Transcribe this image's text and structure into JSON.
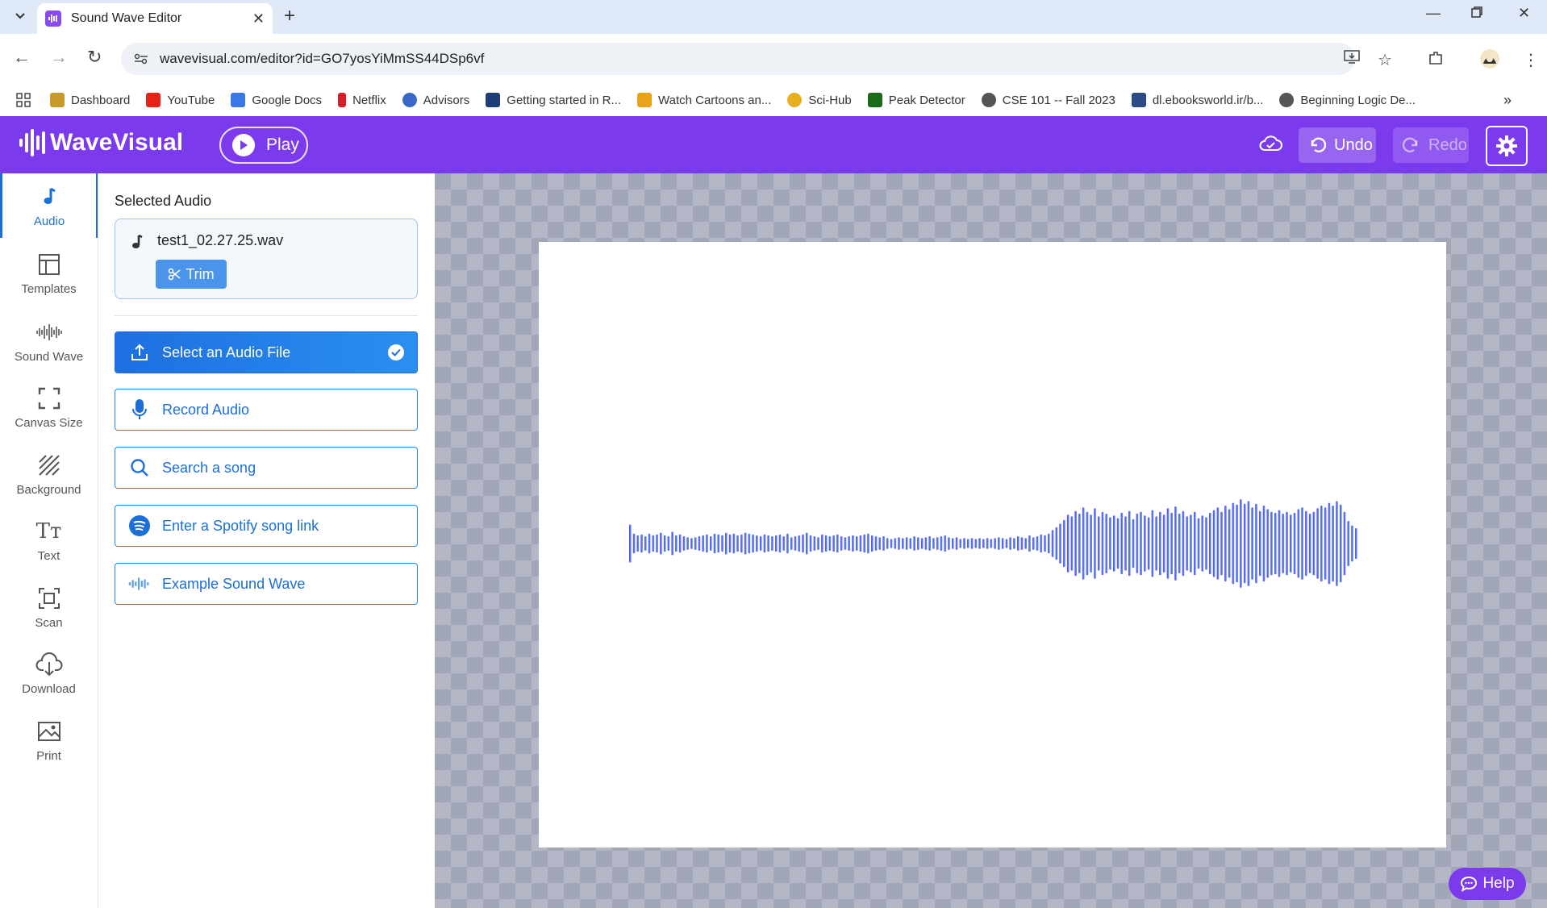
{
  "browser": {
    "tab_title": "Sound Wave Editor",
    "url": "wavevisual.com/editor?id=GO7yosYiMmSS44DSp6vf",
    "bookmarks": [
      {
        "label": "Dashboard",
        "color": "#c79a2a"
      },
      {
        "label": "YouTube",
        "color": "#e62117"
      },
      {
        "label": "Google Docs",
        "color": "#3b78e7"
      },
      {
        "label": "Netflix",
        "color": "#d81f26"
      },
      {
        "label": "Advisors",
        "color": "#3b68c8"
      },
      {
        "label": "Getting started in R...",
        "color": "#1f3e78"
      },
      {
        "label": "Watch Cartoons an...",
        "color": "#e8a31a"
      },
      {
        "label": "Sci-Hub",
        "color": "#e8b020"
      },
      {
        "label": "Peak Detector",
        "color": "#1a6b1a"
      },
      {
        "label": "CSE 101 -- Fall 2023",
        "color": "#555555"
      },
      {
        "label": "dl.ebooksworld.ir/b...",
        "color": "#2a4a88"
      },
      {
        "label": "Beginning Logic De...",
        "color": "#555555"
      }
    ]
  },
  "header": {
    "brand": "WaveVisual",
    "play_label": "Play",
    "undo_label": "Undo",
    "redo_label": "Redo",
    "accent": "#7c3aed"
  },
  "leftnav": {
    "items": [
      {
        "label": "Audio",
        "icon": "music-note-icon",
        "active": true
      },
      {
        "label": "Templates",
        "icon": "templates-icon"
      },
      {
        "label": "Sound Wave",
        "icon": "sound-wave-icon"
      },
      {
        "label": "Canvas Size",
        "icon": "canvas-size-icon"
      },
      {
        "label": "Background",
        "icon": "background-icon"
      },
      {
        "label": "Text",
        "icon": "text-icon"
      },
      {
        "label": "Scan",
        "icon": "scan-icon"
      },
      {
        "label": "Download",
        "icon": "download-icon"
      },
      {
        "label": "Print",
        "icon": "print-icon"
      }
    ]
  },
  "panel": {
    "title": "Selected Audio",
    "selected_file": "test1_02.27.25.wav",
    "trim_label": "Trim",
    "options": [
      {
        "label": "Select an Audio File",
        "icon": "upload-icon",
        "selected": true
      },
      {
        "label": "Record Audio",
        "icon": "microphone-icon"
      },
      {
        "label": "Search a song",
        "icon": "search-icon"
      },
      {
        "label": "Enter a Spotify song link",
        "icon": "spotify-icon"
      },
      {
        "label": "Example Sound Wave",
        "icon": "wave-icon"
      }
    ]
  },
  "waveform": {
    "color_start": "#7c3aed",
    "color_end": "#3aa8f0",
    "amplitudes": [
      0.42,
      0.22,
      0.18,
      0.2,
      0.16,
      0.22,
      0.18,
      0.2,
      0.24,
      0.18,
      0.16,
      0.26,
      0.18,
      0.2,
      0.16,
      0.14,
      0.12,
      0.14,
      0.16,
      0.18,
      0.2,
      0.16,
      0.22,
      0.2,
      0.18,
      0.24,
      0.2,
      0.22,
      0.18,
      0.2,
      0.24,
      0.22,
      0.2,
      0.18,
      0.16,
      0.2,
      0.18,
      0.16,
      0.18,
      0.2,
      0.16,
      0.22,
      0.14,
      0.16,
      0.18,
      0.2,
      0.24,
      0.18,
      0.16,
      0.14,
      0.2,
      0.18,
      0.16,
      0.18,
      0.2,
      0.16,
      0.14,
      0.16,
      0.18,
      0.16,
      0.18,
      0.2,
      0.22,
      0.18,
      0.16,
      0.14,
      0.16,
      0.12,
      0.1,
      0.12,
      0.14,
      0.12,
      0.14,
      0.12,
      0.16,
      0.14,
      0.12,
      0.14,
      0.16,
      0.12,
      0.14,
      0.16,
      0.18,
      0.14,
      0.12,
      0.14,
      0.1,
      0.12,
      0.1,
      0.12,
      0.1,
      0.12,
      0.1,
      0.12,
      0.1,
      0.12,
      0.14,
      0.12,
      0.1,
      0.14,
      0.12,
      0.16,
      0.14,
      0.12,
      0.18,
      0.14,
      0.16,
      0.2,
      0.18,
      0.22,
      0.3,
      0.36,
      0.44,
      0.52,
      0.64,
      0.6,
      0.72,
      0.66,
      0.8,
      0.7,
      0.64,
      0.78,
      0.6,
      0.7,
      0.66,
      0.58,
      0.62,
      0.56,
      0.68,
      0.6,
      0.72,
      0.54,
      0.66,
      0.7,
      0.62,
      0.58,
      0.74,
      0.6,
      0.7,
      0.64,
      0.78,
      0.68,
      0.82,
      0.66,
      0.72,
      0.6,
      0.64,
      0.7,
      0.56,
      0.62,
      0.58,
      0.68,
      0.74,
      0.8,
      0.7,
      0.84,
      0.76,
      0.9,
      0.86,
      0.98,
      0.88,
      0.94,
      0.8,
      0.88,
      0.72,
      0.84,
      0.76,
      0.7,
      0.68,
      0.74,
      0.66,
      0.7,
      0.64,
      0.68,
      0.76,
      0.8,
      0.72,
      0.66,
      0.7,
      0.78,
      0.84,
      0.8,
      0.9,
      0.84,
      0.94,
      0.86,
      0.7,
      0.5,
      0.4,
      0.34
    ]
  }
}
